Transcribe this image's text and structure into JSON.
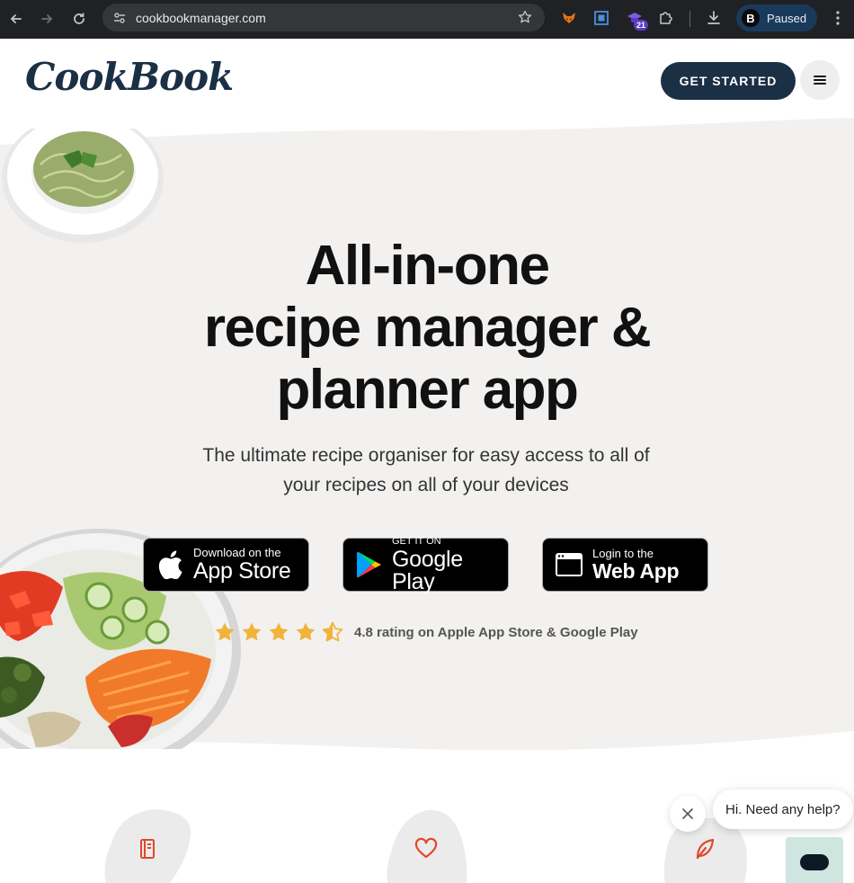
{
  "browser": {
    "url": "cookbookmanager.com",
    "extension_badge": "21",
    "profile_label": "Paused",
    "profile_initial": "B"
  },
  "header": {
    "logo_text": "CookBook",
    "cta_label": "GET STARTED"
  },
  "hero": {
    "title_lines": [
      "All-in-one",
      "recipe manager &",
      "planner app"
    ],
    "subtitle": "The ultimate recipe organiser for easy access to all of your recipes on all of your devices",
    "store_buttons": [
      {
        "small": "Download on the",
        "big": "App Store"
      },
      {
        "small": "GET IT ON",
        "big": "Google Play"
      },
      {
        "small": "Login to the",
        "big": "Web App"
      }
    ],
    "rating_value": 4.5,
    "rating_text": "4.8 rating on Apple App Store & Google Play"
  },
  "features": {
    "icons": [
      "notebook-icon",
      "heart-icon",
      "leaf-icon"
    ],
    "accent_color": "#e2472b"
  },
  "chat": {
    "message": "Hi. Need any help?"
  },
  "colors": {
    "brand_dark": "#1b2f45",
    "star": "#f2b33a",
    "hero_bg": "#f2f1ef"
  }
}
